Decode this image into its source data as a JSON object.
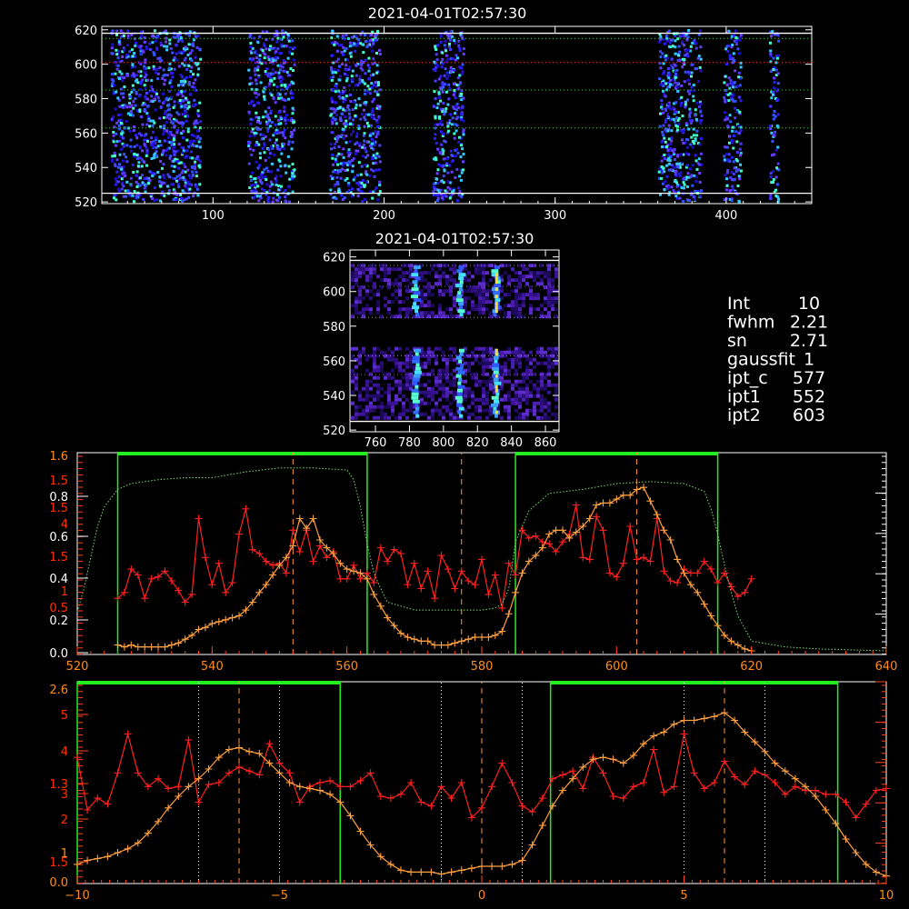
{
  "chart_data": [
    {
      "id": "top-image",
      "type": "heatmap",
      "title": "2021-04-01T02:57:30",
      "x_ticks": [
        "100",
        "200",
        "300",
        "400"
      ],
      "y_ticks": [
        "520",
        "540",
        "560",
        "580",
        "600",
        "620"
      ],
      "xlim": [
        35,
        450
      ],
      "ylim": [
        519,
        622
      ],
      "white_lines_y": [
        525,
        618
      ],
      "green_dotted_y": [
        563,
        585,
        615
      ],
      "red_dotted_y": [
        601
      ],
      "columns": [
        {
          "x0": 40,
          "x1": 92
        },
        {
          "x0": 120,
          "x1": 147
        },
        {
          "x0": 168,
          "x1": 197
        },
        {
          "x0": 228,
          "x1": 246
        },
        {
          "x0": 360,
          "x1": 385
        },
        {
          "x0": 398,
          "x1": 408
        },
        {
          "x0": 425,
          "x1": 430
        }
      ]
    },
    {
      "id": "middle-image",
      "type": "heatmap",
      "title": "2021-04-01T02:57:30",
      "x_ticks": [
        "760",
        "780",
        "800",
        "820",
        "840",
        "860"
      ],
      "y_ticks": [
        "520",
        "540",
        "560",
        "580",
        "600",
        "620"
      ],
      "xlim": [
        745,
        868
      ],
      "ylim": [
        519,
        624
      ],
      "white_lines_y": [
        525,
        618
      ],
      "green_dotted_y": [
        563,
        585,
        615
      ],
      "red_dotted_y": [
        552,
        603
      ],
      "streaks_x": [
        784,
        810,
        831
      ]
    },
    {
      "id": "panel-3",
      "type": "line",
      "x_ticks": [
        "520",
        "540",
        "560",
        "580",
        "600",
        "620",
        "640"
      ],
      "xlim": [
        520,
        640
      ],
      "left_ticks_white": [
        "0.0",
        "0.2",
        "0.4",
        "0.6",
        "0.8"
      ],
      "left_ticks_red": [
        "0.5",
        "1",
        "1.5",
        "1.5",
        "4",
        "1.5"
      ],
      "left_ticks_orange": [
        "1.6"
      ],
      "green_boxes": [
        [
          526,
          563
        ],
        [
          585,
          615
        ]
      ],
      "dashed_orange_x": [
        552,
        577,
        603
      ],
      "series": [
        {
          "color": "#ff2020",
          "x": [
            526,
            527,
            528,
            529,
            530,
            531,
            532,
            533,
            534,
            535,
            536,
            537,
            538,
            539,
            540,
            541,
            542,
            543,
            544,
            545,
            546,
            547,
            548,
            549,
            550,
            551,
            552,
            553,
            554,
            555,
            556,
            557,
            558,
            559,
            560,
            561,
            562,
            563,
            564,
            565,
            566,
            567,
            568,
            569,
            570,
            571,
            572,
            573,
            574,
            575,
            576,
            577,
            578,
            579,
            580,
            581,
            582,
            583,
            584,
            585,
            586,
            587,
            588,
            589,
            590,
            591,
            592,
            593,
            594,
            595,
            596,
            597,
            598,
            599,
            600,
            601,
            602,
            603,
            604,
            605,
            606,
            607,
            608,
            609,
            610,
            611,
            612,
            613,
            614,
            615,
            616,
            617,
            618,
            619,
            620
          ],
          "y": [
            0.27,
            0.3,
            0.42,
            0.39,
            0.27,
            0.37,
            0.38,
            0.41,
            0.36,
            0.31,
            0.25,
            0.29,
            0.68,
            0.48,
            0.34,
            0.45,
            0.3,
            0.35,
            0.6,
            0.73,
            0.52,
            0.5,
            0.46,
            0.44,
            0.45,
            0.4,
            0.62,
            0.51,
            0.62,
            0.46,
            0.54,
            0.48,
            0.51,
            0.37,
            0.37,
            0.44,
            0.37,
            0.4,
            0.35,
            0.53,
            0.46,
            0.52,
            0.5,
            0.34,
            0.45,
            0.32,
            0.41,
            0.27,
            0.49,
            0.42,
            0.32,
            0.41,
            0.36,
            0.34,
            0.47,
            0.29,
            0.39,
            0.22,
            0.45,
            0.39,
            0.62,
            0.58,
            0.59,
            0.56,
            0.55,
            0.51,
            0.56,
            0.6,
            0.75,
            0.48,
            0.47,
            0.69,
            0.62,
            0.4,
            0.38,
            0.45,
            0.64,
            0.47,
            0.48,
            0.46,
            0.68,
            0.41,
            0.36,
            0.35,
            0.42,
            0.4,
            0.4,
            0.46,
            0.42,
            0.35,
            0.4,
            0.33,
            0.28,
            0.3,
            0.37
          ]
        },
        {
          "color": "#ffa040",
          "x": [
            526,
            527,
            528,
            529,
            530,
            531,
            532,
            533,
            534,
            535,
            536,
            537,
            538,
            539,
            540,
            541,
            542,
            543,
            544,
            545,
            546,
            547,
            548,
            549,
            550,
            551,
            552,
            553,
            554,
            555,
            556,
            557,
            558,
            559,
            560,
            561,
            562,
            563,
            564,
            565,
            566,
            567,
            568,
            569,
            570,
            571,
            572,
            573,
            574,
            575,
            576,
            577,
            578,
            579,
            580,
            581,
            582,
            583,
            584,
            585,
            586,
            587,
            588,
            589,
            590,
            591,
            592,
            593,
            594,
            595,
            596,
            597,
            598,
            599,
            600,
            601,
            602,
            603,
            604,
            605,
            606,
            607,
            608,
            609,
            610,
            611,
            612,
            613,
            614,
            615,
            616,
            617,
            618,
            619,
            620
          ],
          "y": [
            0.03,
            0.02,
            0.03,
            0.02,
            0.02,
            0.02,
            0.02,
            0.02,
            0.03,
            0.04,
            0.06,
            0.08,
            0.11,
            0.12,
            0.14,
            0.15,
            0.16,
            0.17,
            0.18,
            0.21,
            0.25,
            0.3,
            0.34,
            0.39,
            0.44,
            0.48,
            0.54,
            0.68,
            0.63,
            0.68,
            0.57,
            0.53,
            0.5,
            0.45,
            0.42,
            0.41,
            0.4,
            0.37,
            0.29,
            0.23,
            0.17,
            0.13,
            0.09,
            0.07,
            0.06,
            0.05,
            0.05,
            0.03,
            0.03,
            0.03,
            0.04,
            0.05,
            0.06,
            0.07,
            0.07,
            0.07,
            0.08,
            0.1,
            0.19,
            0.3,
            0.4,
            0.46,
            0.49,
            0.53,
            0.6,
            0.62,
            0.62,
            0.58,
            0.61,
            0.64,
            0.68,
            0.75,
            0.76,
            0.76,
            0.78,
            0.8,
            0.8,
            0.83,
            0.84,
            0.77,
            0.7,
            0.62,
            0.57,
            0.47,
            0.4,
            0.34,
            0.3,
            0.24,
            0.18,
            0.13,
            0.08,
            0.05,
            0.03,
            0.01,
            0.0
          ]
        },
        {
          "color": "#7dde6e",
          "dotted": true,
          "x": [
            520,
            521,
            522,
            523,
            524,
            526,
            528,
            532,
            536,
            540,
            545,
            550,
            555,
            560,
            561,
            562,
            563,
            564,
            565,
            566,
            570,
            575,
            580,
            582,
            583,
            584,
            585,
            587,
            590,
            595,
            600,
            605,
            610,
            613,
            614,
            615,
            616,
            617,
            618,
            620,
            625,
            630,
            640
          ],
          "y": [
            0.2,
            0.32,
            0.48,
            0.64,
            0.74,
            0.83,
            0.86,
            0.88,
            0.89,
            0.89,
            0.92,
            0.94,
            0.94,
            0.93,
            0.88,
            0.74,
            0.55,
            0.4,
            0.32,
            0.25,
            0.21,
            0.21,
            0.21,
            0.22,
            0.24,
            0.32,
            0.56,
            0.72,
            0.81,
            0.83,
            0.86,
            0.87,
            0.86,
            0.82,
            0.73,
            0.6,
            0.44,
            0.3,
            0.18,
            0.05,
            0.02,
            0.01,
            0.0
          ]
        }
      ]
    },
    {
      "id": "panel-4",
      "type": "line",
      "x_ticks": [
        "−10",
        "−5",
        "0",
        "5",
        "10"
      ],
      "xlim": [
        -10,
        10
      ],
      "left_ticks_orange": [
        "0.0",
        "1",
        "2.6"
      ],
      "left_ticks_red": [
        "1.5",
        "2",
        "3",
        "4",
        "5",
        "1.3",
        "5"
      ],
      "green_boxes": [
        [
          -10,
          -3.5
        ],
        [
          1.7,
          8.8
        ]
      ],
      "dashed_orange_x": [
        -6.0,
        0.0,
        6.0
      ],
      "dotted_white_x": [
        -7.0,
        -5.0,
        -1.0,
        1.0,
        5.0,
        7.0
      ],
      "series": [
        {
          "color": "#ff2020",
          "x": [
            -10,
            -9.75,
            -9.5,
            -9.25,
            -9,
            -8.75,
            -8.5,
            -8.25,
            -8,
            -7.75,
            -7.5,
            -7.25,
            -7,
            -6.75,
            -6.5,
            -6.25,
            -6,
            -5.75,
            -5.5,
            -5.25,
            -5,
            -4.75,
            -4.5,
            -4.25,
            -4,
            -3.75,
            -3.5,
            -3.25,
            -3,
            -2.75,
            -2.5,
            -2.25,
            -2,
            -1.75,
            -1.5,
            -1.25,
            -1,
            -0.75,
            -0.5,
            -0.25,
            0,
            0.25,
            0.5,
            0.75,
            1,
            1.25,
            1.5,
            1.75,
            2,
            2.25,
            2.5,
            2.75,
            3,
            3.25,
            3.5,
            3.75,
            4,
            4.25,
            4.5,
            4.75,
            5,
            5.25,
            5.5,
            5.75,
            6,
            6.25,
            6.5,
            6.75,
            7,
            7.25,
            7.5,
            7.75,
            8,
            8.25,
            8.5,
            8.75,
            9,
            9.25,
            9.5,
            9.75,
            10
          ],
          "y": [
            0.63,
            0.36,
            0.42,
            0.39,
            0.55,
            0.75,
            0.55,
            0.48,
            0.52,
            0.47,
            0.48,
            0.72,
            0.4,
            0.49,
            0.5,
            0.55,
            0.58,
            0.56,
            0.54,
            0.7,
            0.6,
            0.55,
            0.4,
            0.48,
            0.5,
            0.51,
            0.48,
            0.48,
            0.51,
            0.55,
            0.43,
            0.42,
            0.44,
            0.5,
            0.4,
            0.38,
            0.48,
            0.42,
            0.5,
            0.32,
            0.37,
            0.48,
            0.6,
            0.5,
            0.38,
            0.35,
            0.42,
            0.52,
            0.54,
            0.56,
            0.47,
            0.63,
            0.55,
            0.43,
            0.42,
            0.48,
            0.5,
            0.67,
            0.45,
            0.48,
            0.75,
            0.55,
            0.47,
            0.5,
            0.61,
            0.53,
            0.49,
            0.56,
            0.54,
            0.5,
            0.44,
            0.48,
            0.46,
            0.46,
            0.44,
            0.44,
            0.4,
            0.32,
            0.39,
            0.46,
            0.47
          ]
        },
        {
          "color": "#ffa040",
          "x": [
            -10,
            -9.75,
            -9.5,
            -9.25,
            -9,
            -8.75,
            -8.5,
            -8.25,
            -8,
            -7.75,
            -7.5,
            -7.25,
            -7,
            -6.75,
            -6.5,
            -6.25,
            -6,
            -5.75,
            -5.5,
            -5.25,
            -5,
            -4.75,
            -4.5,
            -4.25,
            -4,
            -3.75,
            -3.5,
            -3.25,
            -3,
            -2.75,
            -2.5,
            -2.25,
            -2,
            -1.75,
            -1.5,
            -1.25,
            -1,
            -0.75,
            -0.5,
            -0.25,
            0,
            0.25,
            0.5,
            0.75,
            1,
            1.25,
            1.5,
            1.75,
            2,
            2.25,
            2.5,
            2.75,
            3,
            3.25,
            3.5,
            3.75,
            4,
            4.25,
            4.5,
            4.75,
            5,
            5.25,
            5.5,
            5.75,
            6,
            6.25,
            6.5,
            6.75,
            7,
            7.25,
            7.5,
            7.75,
            8,
            8.25,
            8.5,
            8.75,
            9,
            9.25,
            9.5,
            9.75,
            10
          ],
          "y": [
            0.08,
            0.1,
            0.11,
            0.12,
            0.14,
            0.16,
            0.19,
            0.24,
            0.3,
            0.37,
            0.43,
            0.48,
            0.52,
            0.57,
            0.63,
            0.67,
            0.68,
            0.66,
            0.65,
            0.6,
            0.55,
            0.5,
            0.48,
            0.47,
            0.46,
            0.44,
            0.4,
            0.33,
            0.25,
            0.18,
            0.12,
            0.08,
            0.05,
            0.04,
            0.04,
            0.04,
            0.03,
            0.04,
            0.05,
            0.06,
            0.07,
            0.07,
            0.07,
            0.08,
            0.1,
            0.18,
            0.28,
            0.38,
            0.46,
            0.52,
            0.58,
            0.62,
            0.63,
            0.62,
            0.6,
            0.64,
            0.7,
            0.74,
            0.76,
            0.8,
            0.82,
            0.82,
            0.83,
            0.84,
            0.86,
            0.82,
            0.76,
            0.71,
            0.66,
            0.6,
            0.56,
            0.52,
            0.48,
            0.43,
            0.36,
            0.29,
            0.21,
            0.14,
            0.08,
            0.04,
            0.02
          ]
        }
      ]
    }
  ],
  "info": {
    "lines": [
      {
        "key": "Int",
        "value": "10"
      },
      {
        "key": "fwhm",
        "value": "2.21"
      },
      {
        "key": "sn",
        "value": "2.71"
      },
      {
        "key": "gaussfit",
        "value": "1"
      },
      {
        "key": "ipt_c",
        "value": "577"
      },
      {
        "key": "ipt1",
        "value": "552"
      },
      {
        "key": "ipt2",
        "value": "603"
      }
    ]
  },
  "colors": {
    "axis": "#ffffff",
    "red_series": "#ff2020",
    "orange_series": "#ffa040",
    "green_box": "#22ee22",
    "green_profile": "#7dde6e",
    "dashed": "#ff9933"
  }
}
